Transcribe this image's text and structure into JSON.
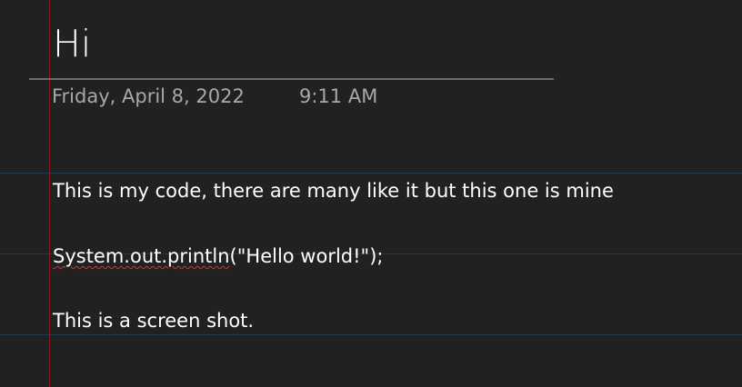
{
  "page": {
    "title": "Hi",
    "date": "Friday, April 8, 2022",
    "time": "9:11 AM"
  },
  "content": {
    "line1": "This is my code, there are many like it but this one is mine",
    "code_misspelled": "System.out.println",
    "code_rest": "(\"Hello world!\");",
    "line3": "This is a screen shot."
  },
  "colors": {
    "background": "#212121",
    "rule_lines": "#1e3a52",
    "margin_line": "#8b1a1a",
    "spellcheck_underline": "#e03030",
    "meta_text": "#a8a8a8"
  }
}
